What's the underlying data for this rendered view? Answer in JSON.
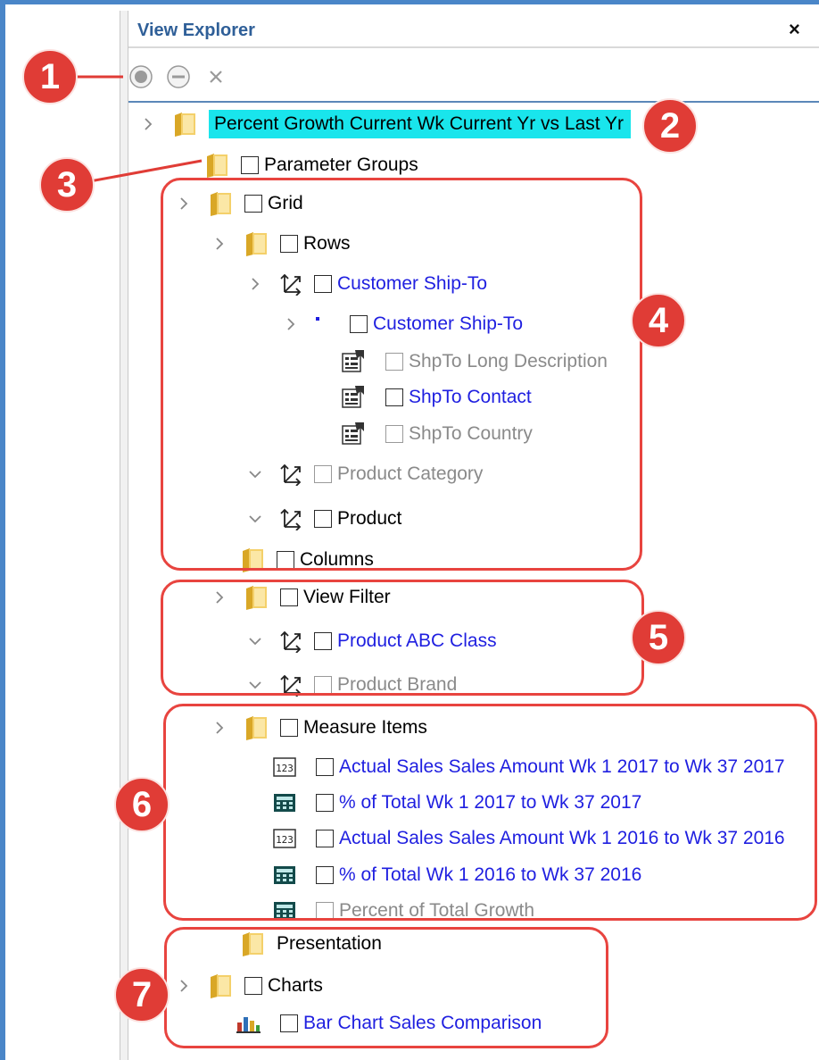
{
  "panel": {
    "title": "View Explorer",
    "close_glyph": "×"
  },
  "toolbar": [
    {
      "name": "select-all-icon"
    },
    {
      "name": "deselect-icon"
    },
    {
      "name": "remove-icon"
    }
  ],
  "tree": {
    "root": "Percent Growth Current Wk Current Yr vs Last Yr",
    "parameter_groups": "Parameter Groups",
    "grid": "Grid",
    "rows": "Rows",
    "customer_ship_to_hierarchy": "Customer Ship-To",
    "customer_ship_to_level": "Customer Ship-To",
    "attr_long_description": "ShpTo Long Description",
    "attr_contact": "ShpTo Contact",
    "attr_country": "ShpTo Country",
    "product_category": "Product Category",
    "product": "Product",
    "columns": "Columns",
    "view_filter": "View Filter",
    "product_abc_class": "Product ABC Class",
    "product_brand": "Product Brand",
    "measure_items": "Measure Items",
    "measure_1": "Actual Sales Sales Amount Wk 1 2017 to Wk 37 2017",
    "measure_2": "% of Total Wk 1 2017 to Wk 37 2017",
    "measure_3": "Actual Sales Sales Amount Wk 1 2016 to Wk 37 2016",
    "measure_4": "% of Total Wk 1 2016 to Wk 37 2016",
    "measure_5": "Percent of Total Growth",
    "presentation": "Presentation",
    "charts": "Charts",
    "chart_1": "Bar Chart Sales Comparison"
  },
  "callouts": [
    "1",
    "2",
    "3",
    "4",
    "5",
    "6",
    "7"
  ],
  "colors": {
    "accent": "#4a86c8",
    "highlight": "#19e5ec",
    "callout": "#e03c36",
    "link": "#1f1fe0"
  }
}
